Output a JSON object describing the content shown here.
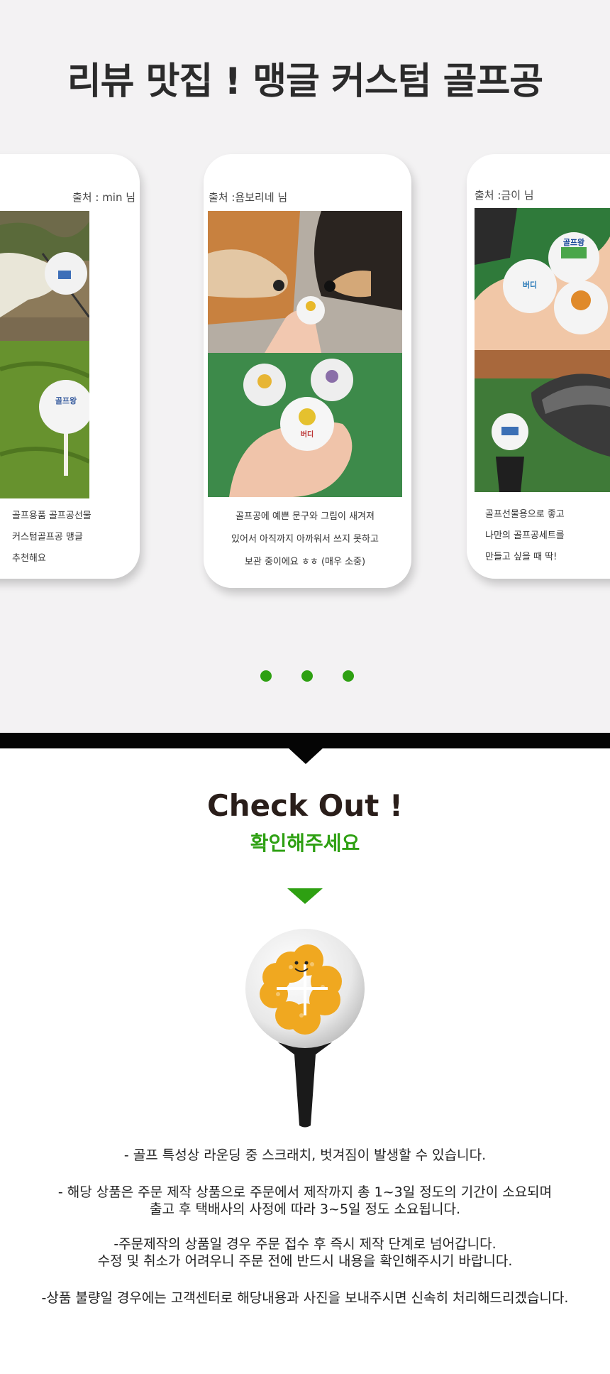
{
  "review": {
    "title": "리뷰 맛집 ! 맹글 커스텀 골프공",
    "cards": [
      {
        "source": "출처 : min 님",
        "lines": [
          "골프용품 골프공선물",
          "커스텀골프공 맹글",
          "추천해요"
        ],
        "ball_label": "골프왕"
      },
      {
        "source": "출처 :욤보리네 님",
        "lines": [
          "골프공에 예쁜 문구와 그림이 새겨져",
          "있어서 아직까지 아까워서 쓰지 못하고",
          "보관 중이에요 ㅎㅎ (매우 소중)"
        ],
        "ball_label": "버디"
      },
      {
        "source": "출처 :금이 님",
        "lines": [
          "골프선물용으로 좋고",
          "나만의 골프공세트를",
          "만들고 싶을 때 딱!"
        ],
        "ball_label": "골프왕",
        "ball_label_2": "버디"
      }
    ],
    "dots_count": 3
  },
  "check": {
    "title": "Check Out !",
    "subtitle": "확인해주세요"
  },
  "notices": [
    [
      "- 골프 특성상 라운딩 중 스크래치, 벗겨짐이 발생할 수 있습니다."
    ],
    [
      "- 해당 상품은 주문 제작 상품으로 주문에서 제작까지 총 1~3일 정도의 기간이 소요되며",
      "출고 후 택배사의 사정에 따라 3~5일 정도 소요됩니다."
    ],
    [
      "-주문제작의 상품일 경우 주문 접수 후 즉시 제작 단계로 넘어갑니다.",
      "수정 및 취소가 어려우니 주문 전에 반드시 내용을 확인해주시기 바랍니다."
    ],
    [
      "-상품 불량일 경우에는 고객센터로 해당내용과 사진을 보내주시면 신속히 처리해드리겠습니다."
    ]
  ],
  "colors": {
    "accent_green": "#2ea012",
    "section_bg": "#f3f2f3",
    "title_dark": "#2a1e1a"
  }
}
